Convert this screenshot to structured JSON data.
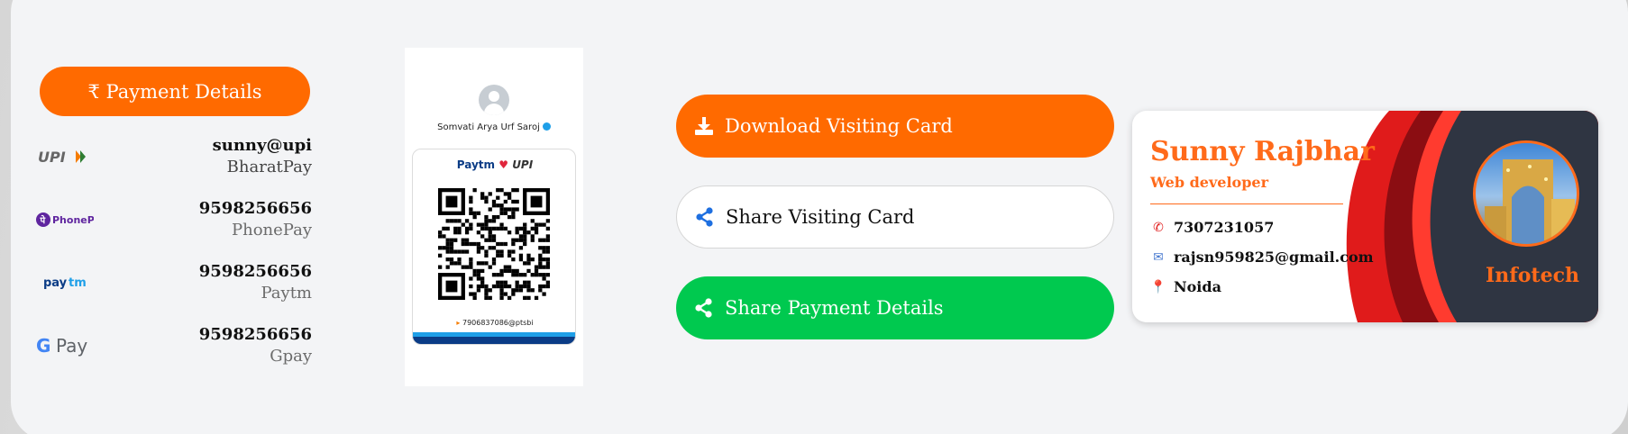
{
  "payment": {
    "button_label": "₹ Payment Details",
    "methods": [
      {
        "logo": "UPI",
        "id": "sunny@upi",
        "name": "BharatPay"
      },
      {
        "logo": "PhonePe",
        "id": "9598256656",
        "name": "PhonePay"
      },
      {
        "logo": "Paytm",
        "id": "9598256656",
        "name": "Paytm"
      },
      {
        "logo": "G Pay",
        "id": "9598256656",
        "name": "Gpay"
      }
    ]
  },
  "qr": {
    "owner": "Somvati Arya Urf Saroj",
    "brand_paytm": "Paytm",
    "brand_heart": "♥",
    "brand_upi": "UPI",
    "handle": "7906837086@ptsbi"
  },
  "actions": {
    "download": "Download Visiting Card",
    "share_card": "Share Visiting Card",
    "share_payment": "Share Payment Details"
  },
  "card": {
    "name": "Sunny Rajbhar",
    "role": "Web developer",
    "phone": "7307231057",
    "email": "rajsn959825@gmail.com",
    "location": "Noida",
    "company": "Infotech"
  },
  "colors": {
    "accent_orange": "#ff6a00",
    "share_green": "#00c94f",
    "card_dark": "#2f3542",
    "card_red": "#e01b1b"
  }
}
